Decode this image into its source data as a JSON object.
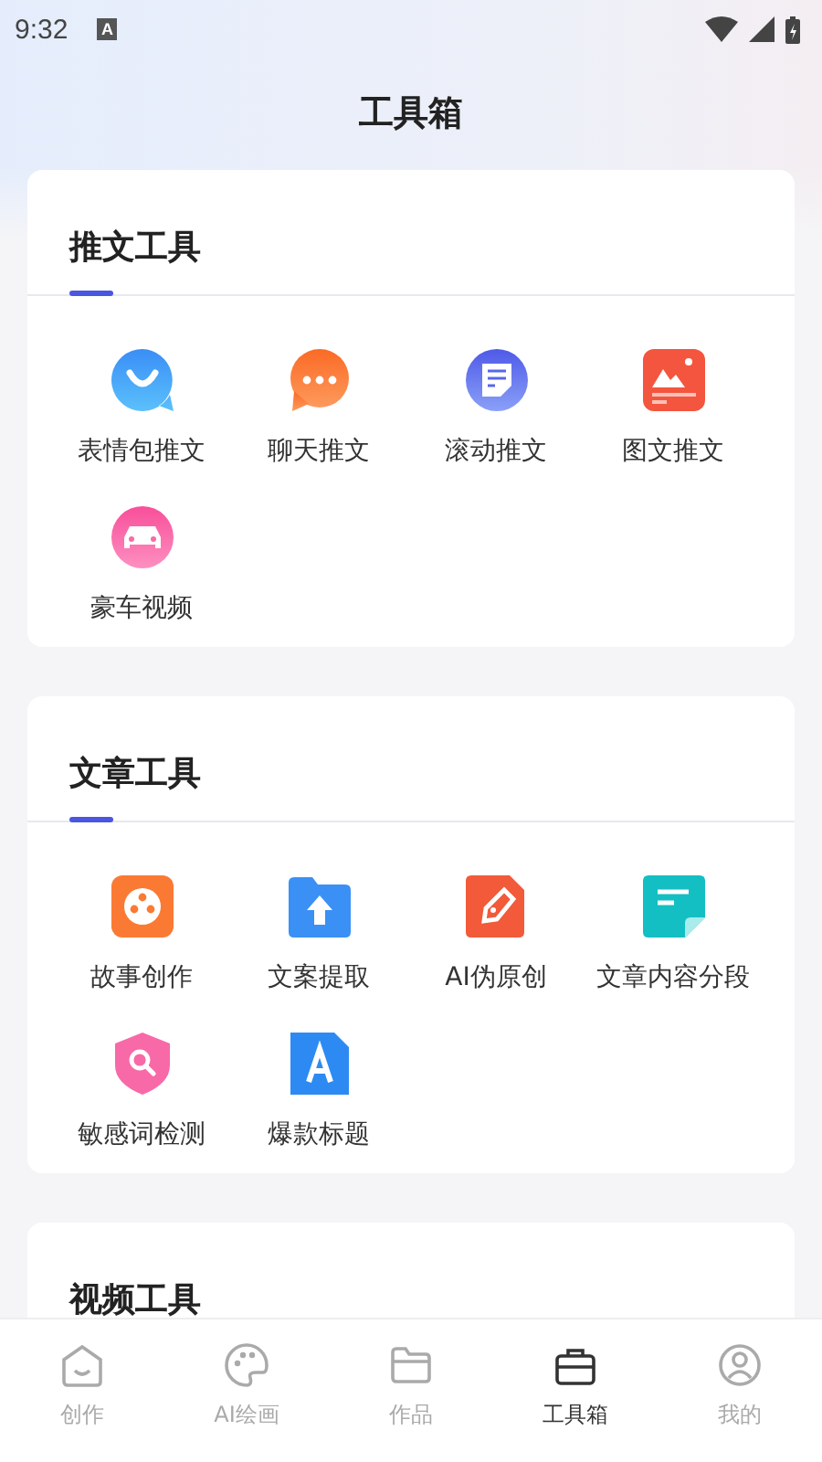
{
  "status_bar": {
    "time": "9:32",
    "notification_glyph": "A"
  },
  "header": {
    "title": "工具箱"
  },
  "sections": [
    {
      "title": "推文工具",
      "tools": [
        "表情包推文",
        "聊天推文",
        "滚动推文",
        "图文推文",
        "豪车视频"
      ]
    },
    {
      "title": "文章工具",
      "tools": [
        "故事创作",
        "文案提取",
        "AI伪原创",
        "文章内容分段",
        "敏感词检测",
        "爆款标题"
      ]
    },
    {
      "title": "视频工具"
    }
  ],
  "tab_bar": [
    {
      "label": "创作",
      "selected": false
    },
    {
      "label": "AI绘画",
      "selected": false
    },
    {
      "label": "作品",
      "selected": false
    },
    {
      "label": "工具箱",
      "selected": true
    },
    {
      "label": "我的",
      "selected": false
    }
  ]
}
